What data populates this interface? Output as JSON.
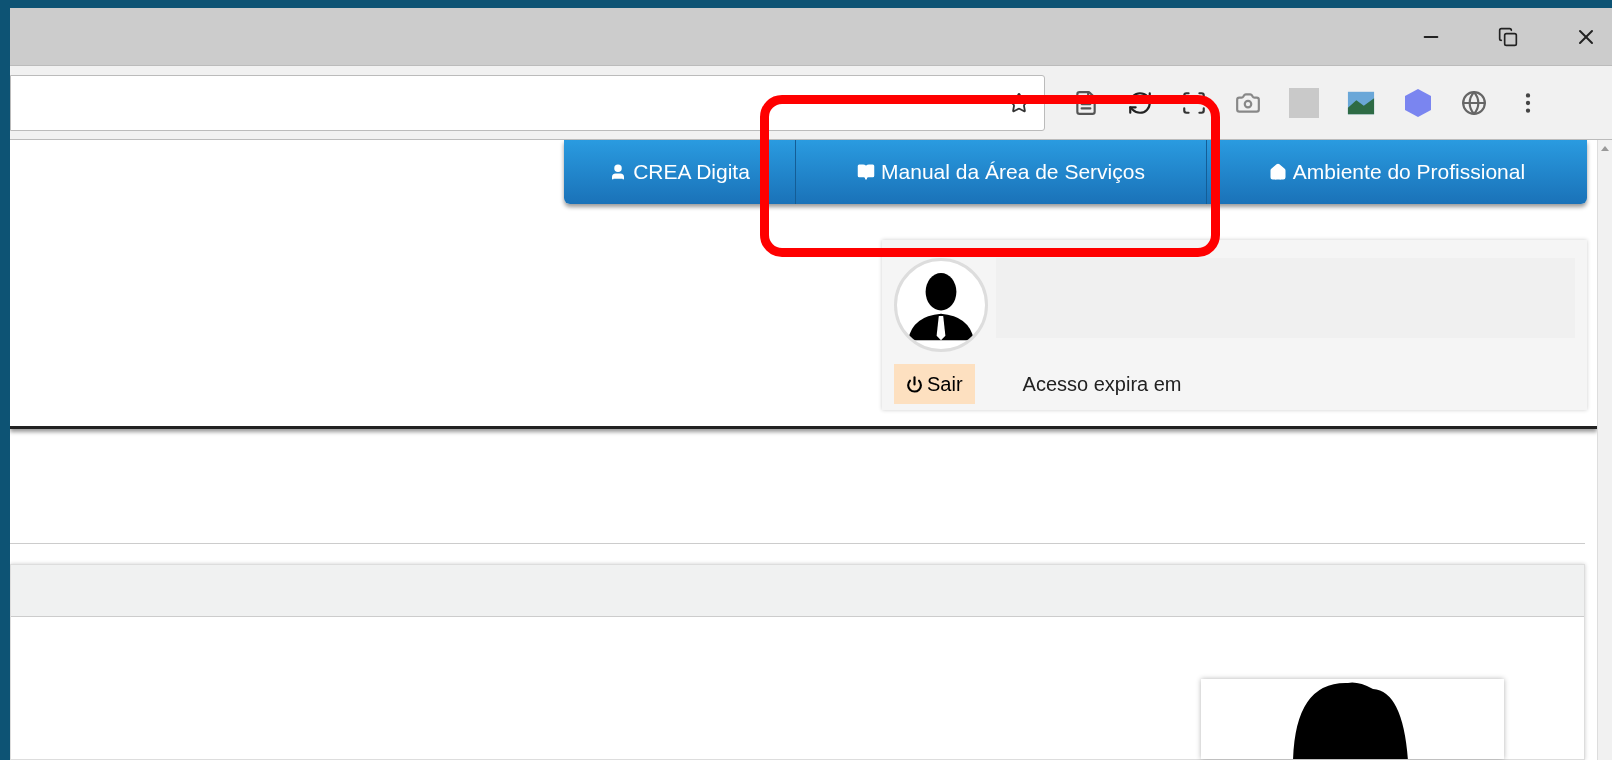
{
  "nav": {
    "items": [
      {
        "label": "CREA Digita"
      },
      {
        "label": "Manual da Área de Serviços"
      },
      {
        "label": "Ambiente do Profissional"
      }
    ]
  },
  "profile": {
    "logout": "Sair",
    "expiry_label": "Acesso expira em"
  }
}
